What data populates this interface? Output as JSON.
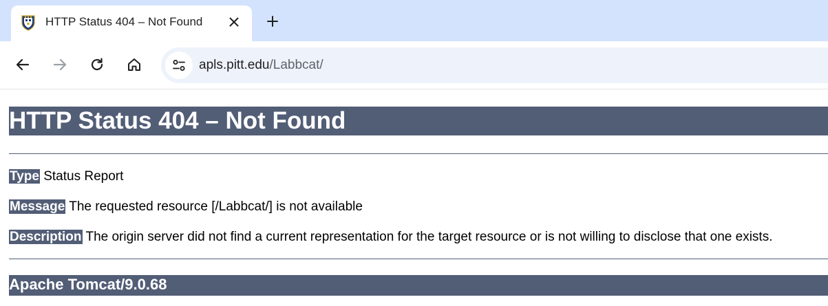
{
  "browser": {
    "tab": {
      "title": "HTTP Status 404 – Not Found",
      "favicon": "pitt-shield-icon"
    },
    "new_tab_icon": "plus-icon",
    "close_icon": "close-icon",
    "nav": {
      "back_icon": "back-arrow-icon",
      "forward_icon": "forward-arrow-icon",
      "reload_icon": "reload-icon",
      "home_icon": "home-icon"
    },
    "address_bar": {
      "host": "apls.pitt.edu",
      "path": "/Labbcat/",
      "site_info_icon": "site-settings-icon"
    },
    "colors": {
      "tabstrip": "#d3e3fd",
      "omnibox": "#eef3fb"
    }
  },
  "page": {
    "heading": "HTTP Status 404 – Not Found",
    "type_label": "Type",
    "type_value": "Status Report",
    "message_label": "Message",
    "message_value": "The requested resource [/Labbcat/] is not available",
    "description_label": "Description",
    "description_value": "The origin server did not find a current representation for the target resource or is not willing to disclose that one exists.",
    "footer": "Apache Tomcat/9.0.68",
    "colors": {
      "header_bg": "#525d76",
      "header_text": "#ffffff"
    }
  }
}
